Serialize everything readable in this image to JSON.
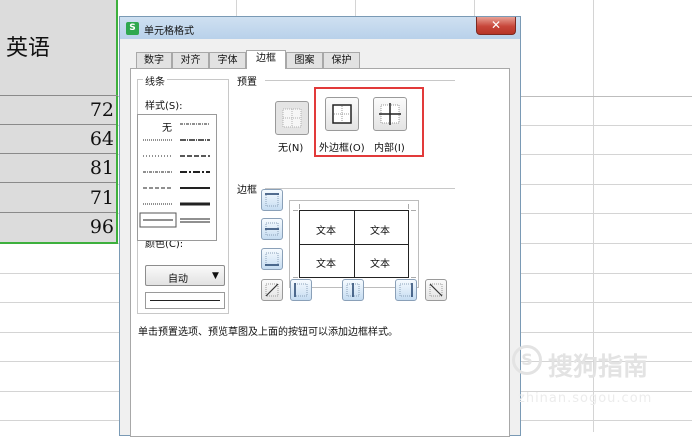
{
  "spreadsheet": {
    "header": "英语",
    "values": [
      "72",
      "64",
      "81",
      "71",
      "96"
    ]
  },
  "dialog": {
    "title": "单元格格式",
    "app_icon_letter": "S",
    "close_glyph": "✕",
    "tabs": [
      "数字",
      "对齐",
      "字体",
      "边框",
      "图案",
      "保护"
    ],
    "active_tab": "边框",
    "line_group": {
      "title": "线条",
      "style_label": "样式(S):",
      "none_label": "无",
      "color_label": "颜色(C):",
      "color_value": "自动",
      "color_arrow": "▼"
    },
    "preset_group": {
      "title": "预置",
      "presets": [
        {
          "label": "无(N)",
          "state": "disabled"
        },
        {
          "label": "外边框(O)",
          "state": "enabled"
        },
        {
          "label": "内部(I)",
          "state": "enabled"
        }
      ],
      "highlight_color": "#e23a3a"
    },
    "border_group": {
      "title": "边框",
      "preview_cells": [
        "文本",
        "文本",
        "文本",
        "文本"
      ]
    },
    "hint": "单击预置选项、预览草图及上面的按钮可以添加边框样式。"
  },
  "watermark": {
    "logo_glyph": "S",
    "text": "搜狗指南",
    "url": "zhinan.sogou.com"
  },
  "colors": {
    "selection_border": "#3db03d",
    "titlebar": "#cfe0f1",
    "close_button": "#c7463a",
    "border_button": "#c5dcf1"
  }
}
